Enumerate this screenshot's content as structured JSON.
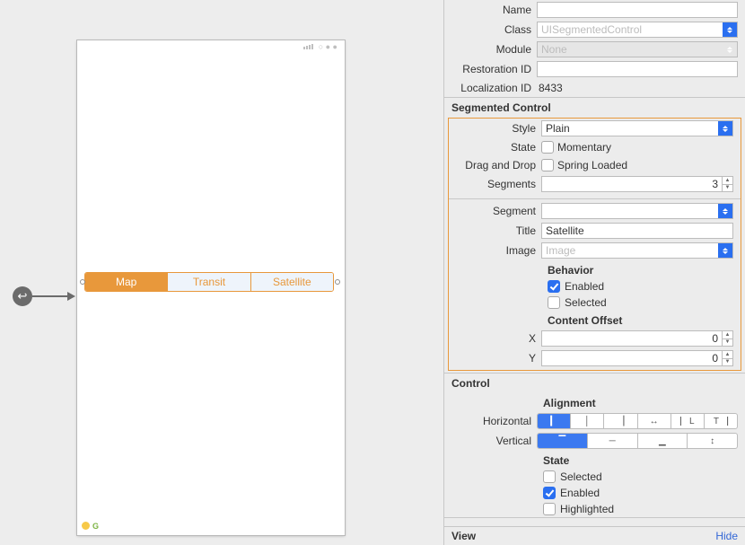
{
  "phone": {
    "segments": {
      "a": "Map",
      "b": "Transit",
      "c": "Satellite"
    },
    "footer_badge": "G"
  },
  "identity": {
    "name_label": "Name",
    "name_value": "",
    "class_label": "Class",
    "class_placeholder": "UISegmentedControl",
    "module_label": "Module",
    "module_placeholder": "None",
    "restoration_label": "Restoration ID",
    "restoration_value": "",
    "localization_label": "Localization ID",
    "localization_value": "8433"
  },
  "segmented": {
    "header": "Segmented Control",
    "style_label": "Style",
    "style_value": "Plain",
    "state_label": "State",
    "momentary_label": "Momentary",
    "dnd_label": "Drag and Drop",
    "spring_label": "Spring Loaded",
    "segments_label": "Segments",
    "segments_value": "3",
    "segment_label": "Segment",
    "segment_value": "",
    "title_label": "Title",
    "title_value": "Satellite",
    "image_label": "Image",
    "image_placeholder": "Image",
    "behavior_header": "Behavior",
    "enabled_label": "Enabled",
    "selected_label": "Selected",
    "offset_header": "Content Offset",
    "x_label": "X",
    "x_value": "0",
    "y_label": "Y",
    "y_value": "0"
  },
  "control": {
    "header": "Control",
    "alignment_header": "Alignment",
    "horizontal_label": "Horizontal",
    "vertical_label": "Vertical",
    "state_header": "State",
    "selected_label": "Selected",
    "enabled_label": "Enabled",
    "highlighted_label": "Highlighted"
  },
  "footer": {
    "view_label": "View",
    "hide_label": "Hide"
  },
  "icons": {
    "updown": "",
    "tri_up": "▲",
    "tri_dn": "▼",
    "h_left": "▎",
    "h_center": "│",
    "h_right": "▕",
    "h_fill": "↔",
    "h_left_text": "⎸L",
    "h_text": "T⎹",
    "v_top": "▔",
    "v_center": "─",
    "v_bottom": "▁",
    "v_fill": "↕"
  }
}
